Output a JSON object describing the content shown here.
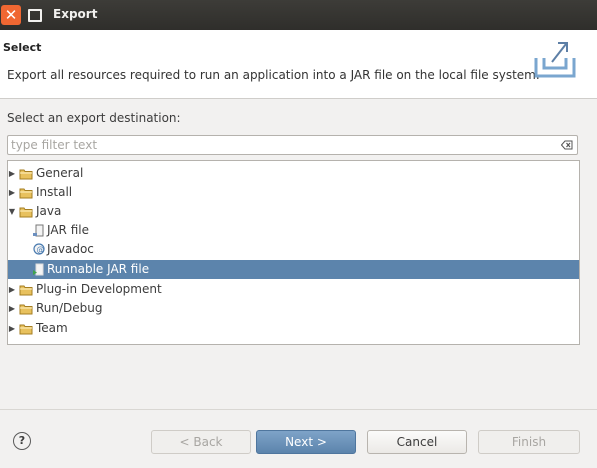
{
  "window": {
    "title": "Export"
  },
  "header": {
    "title": "Select",
    "description": "Export all resources required to run an application into a JAR file on the local file system."
  },
  "main": {
    "destination_label": "Select an export destination:",
    "filter_placeholder": "type filter text",
    "filter_value": ""
  },
  "tree": [
    {
      "label": "General",
      "expanded": false,
      "icon": "folder-icon"
    },
    {
      "label": "Install",
      "expanded": false,
      "icon": "folder-icon"
    },
    {
      "label": "Java",
      "expanded": true,
      "icon": "folder-icon"
    },
    {
      "label": "JAR file",
      "icon": "jar-file-icon"
    },
    {
      "label": "Javadoc",
      "icon": "javadoc-icon"
    },
    {
      "label": "Runnable JAR file",
      "icon": "runnable-jar-icon",
      "selected": true
    },
    {
      "label": "Plug-in Development",
      "expanded": false,
      "icon": "folder-icon"
    },
    {
      "label": "Run/Debug",
      "expanded": false,
      "icon": "folder-icon"
    },
    {
      "label": "Team",
      "expanded": false,
      "icon": "folder-icon"
    }
  ],
  "buttons": {
    "help": "?",
    "back": "< Back",
    "next": "Next >",
    "cancel": "Cancel",
    "finish": "Finish"
  },
  "colors": {
    "selection": "#5c84ac",
    "close_button": "#f06732",
    "folder": "#e8c15e"
  }
}
